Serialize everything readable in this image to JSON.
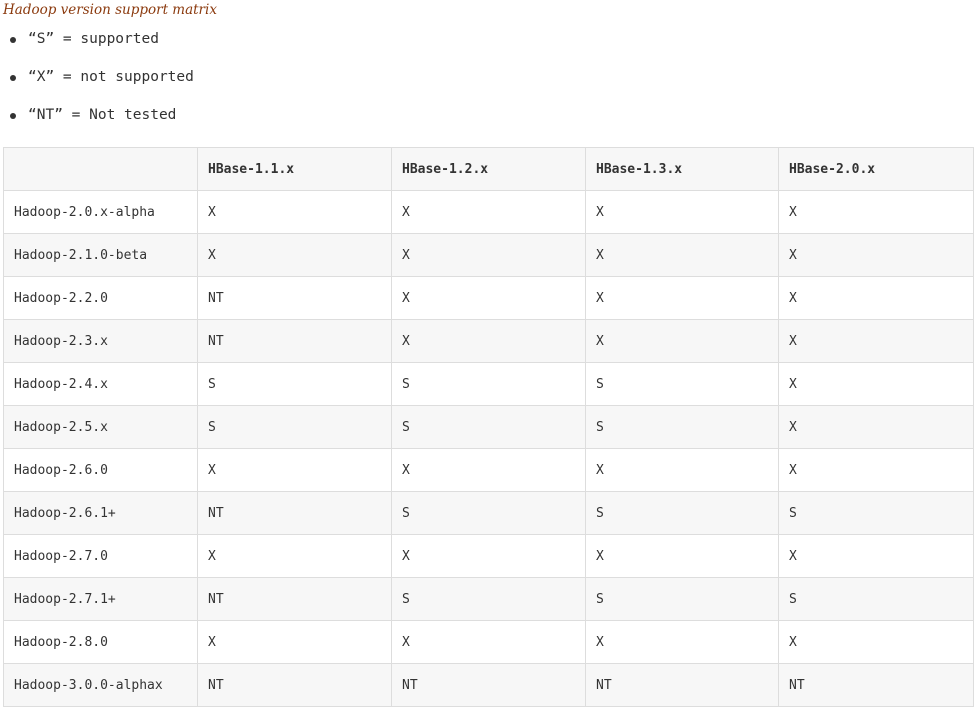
{
  "title": "Hadoop version support matrix",
  "legend": [
    "“S” = supported",
    "“X” = not supported",
    "“NT” = Not tested"
  ],
  "table": {
    "headers": [
      "",
      "HBase-1.1.x",
      "HBase-1.2.x",
      "HBase-1.3.x",
      "HBase-2.0.x"
    ],
    "rows": [
      [
        "Hadoop-2.0.x-alpha",
        "X",
        "X",
        "X",
        "X"
      ],
      [
        "Hadoop-2.1.0-beta",
        "X",
        "X",
        "X",
        "X"
      ],
      [
        "Hadoop-2.2.0",
        "NT",
        "X",
        "X",
        "X"
      ],
      [
        "Hadoop-2.3.x",
        "NT",
        "X",
        "X",
        "X"
      ],
      [
        "Hadoop-2.4.x",
        "S",
        "S",
        "S",
        "X"
      ],
      [
        "Hadoop-2.5.x",
        "S",
        "S",
        "S",
        "X"
      ],
      [
        "Hadoop-2.6.0",
        "X",
        "X",
        "X",
        "X"
      ],
      [
        "Hadoop-2.6.1+",
        "NT",
        "S",
        "S",
        "S"
      ],
      [
        "Hadoop-2.7.0",
        "X",
        "X",
        "X",
        "X"
      ],
      [
        "Hadoop-2.7.1+",
        "NT",
        "S",
        "S",
        "S"
      ],
      [
        "Hadoop-2.8.0",
        "X",
        "X",
        "X",
        "X"
      ],
      [
        "Hadoop-3.0.0-alphax",
        "NT",
        "NT",
        "NT",
        "NT"
      ]
    ]
  }
}
